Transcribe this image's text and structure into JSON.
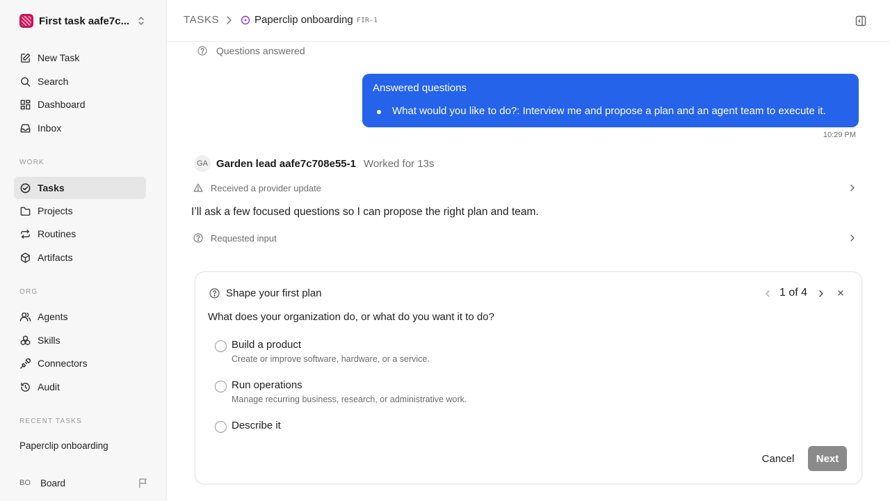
{
  "workspace": {
    "name": "First task aafe7c..."
  },
  "sidebar": {
    "items": [
      {
        "label": "New Task"
      },
      {
        "label": "Search"
      },
      {
        "label": "Dashboard"
      },
      {
        "label": "Inbox"
      }
    ],
    "work_label": "WORK",
    "work_items": [
      {
        "label": "Tasks"
      },
      {
        "label": "Projects"
      },
      {
        "label": "Routines"
      },
      {
        "label": "Artifacts"
      }
    ],
    "org_label": "ORG",
    "org_items": [
      {
        "label": "Agents"
      },
      {
        "label": "Skills"
      },
      {
        "label": "Connectors"
      },
      {
        "label": "Audit"
      }
    ],
    "recent_label": "RECENT TASKS",
    "recent_items": [
      {
        "label": "Paperclip onboarding"
      }
    ],
    "board": {
      "avatar": "BO",
      "label": "Board"
    }
  },
  "header": {
    "crumb_root": "TASKS",
    "title": "Paperclip onboarding",
    "id": "FIR-1"
  },
  "thread": {
    "questions_answered": "Questions answered",
    "bubble": {
      "title": "Answered questions",
      "item": "What would you like to do?: Interview me and propose a plan and an agent team to execute it."
    },
    "time": "10:29 PM",
    "agent": {
      "avatar": "GA",
      "name": "Garden lead aafe7c708e55-1",
      "worked": "Worked for 13s"
    },
    "provider_update": "Received a provider update",
    "message": "I’ll ask a few focused questions so I can propose the right plan and team.",
    "requested_input": "Requested input"
  },
  "card": {
    "title": "Shape your first plan",
    "pager": "1 of 4",
    "question": "What does your organization do, or what do you want it to do?",
    "options": [
      {
        "label": "Build a product",
        "desc": "Create or improve software, hardware, or a service."
      },
      {
        "label": "Run operations",
        "desc": "Manage recurring business, research, or administrative work."
      },
      {
        "label": "Describe it",
        "desc": ""
      }
    ],
    "cancel": "Cancel",
    "next": "Next"
  },
  "colors": {
    "accent": "#2563eb",
    "next_button": "#8a8a8a",
    "brand": "#c2185b"
  }
}
